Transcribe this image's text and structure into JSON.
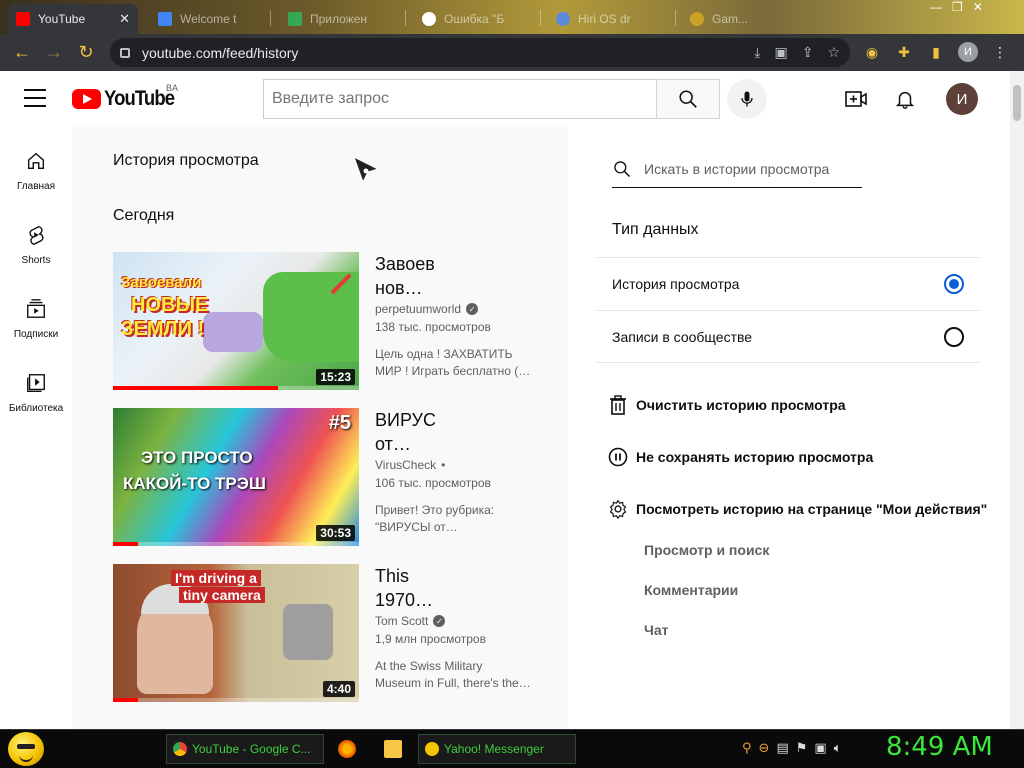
{
  "browser": {
    "active_tab": {
      "title": "YouTube"
    },
    "inactive_tabs": [
      "Welcome t",
      "Приложен",
      "Ошибка \"Б",
      "Hiri OS dr",
      "Gam..."
    ],
    "url": "youtube.com/feed/history",
    "profile_initial": "И"
  },
  "masthead": {
    "logo_text": "YouTube",
    "region": "BA",
    "search_placeholder": "Введите запрос",
    "avatar_initial": "И"
  },
  "guide": [
    {
      "label": "Главная",
      "icon": "home-icon"
    },
    {
      "label": "Shorts",
      "icon": "shorts-icon"
    },
    {
      "label": "Подписки",
      "icon": "subscriptions-icon"
    },
    {
      "label": "Библиотека",
      "icon": "library-icon"
    }
  ],
  "page": {
    "title": "История просмотра",
    "section": "Сегодня"
  },
  "videos": [
    {
      "title_line1": "Завоев",
      "title_line2": "нов…",
      "thumb_text": "Завоевали НОВЫЕ ЗЕМЛИ !",
      "thumb_text_top": "Завоевали",
      "thumb_text_mid": "НОВЫЕ",
      "thumb_text_bot": "ЗЕМЛИ !",
      "channel": "perpetuumworld",
      "verified": true,
      "views": "138 тыс. просмотров",
      "desc_line1": "Цель одна ! ЗАХВАТИТЬ",
      "desc_line2": "МИР ! Играть бесплатно (…",
      "duration": "15:23",
      "progress": 0.67
    },
    {
      "title_line1": "ВИРУС",
      "title_line2": "от…",
      "thumb_text_top": "ЭТО ПРОСТО",
      "thumb_text_bot": "КАКОЙ-ТО ТРЭШ",
      "thumb_badge": "#5",
      "channel": "VirusCheck",
      "verified": false,
      "views": "106 тыс. просмотров",
      "desc_line1": "Привет! Это рубрика:",
      "desc_line2": "\"ВИРУСЫ от…",
      "duration": "30:53",
      "progress": 0.1
    },
    {
      "title_line1": "This",
      "title_line2": "1970…",
      "thumb_text_top": "I'm driving a",
      "thumb_text_bot": "tiny camera",
      "channel": "Tom Scott",
      "verified": true,
      "views": "1,9 млн просмотров",
      "desc_line1": "At the Swiss Military",
      "desc_line2": "Museum in Full, there's the…",
      "duration": "4:40",
      "progress": 0.1
    }
  ],
  "side": {
    "search_placeholder": "Искать в истории просмотра",
    "type_title": "Тип данных",
    "options": [
      {
        "label": "История просмотра",
        "selected": true
      },
      {
        "label": "Записи в сообществе",
        "selected": false
      }
    ],
    "actions": [
      {
        "label": "Очистить историю просмотра",
        "icon": "trash-icon"
      },
      {
        "label": "Не сохранять историю просмотра",
        "icon": "pause-icon"
      },
      {
        "label": "Посмотреть историю на странице \"Мои действия\"",
        "icon": "gear-icon"
      }
    ],
    "links": [
      "Просмотр и поиск",
      "Комментарии",
      "Чат"
    ]
  },
  "taskbar": {
    "tasks": [
      "YouTube - Google C...",
      "Yahoo! Messenger"
    ],
    "clock": "8:49 AM"
  },
  "colors": {
    "accent": "#065fd4",
    "brand": "#ff0000",
    "clock": "#39e639"
  }
}
